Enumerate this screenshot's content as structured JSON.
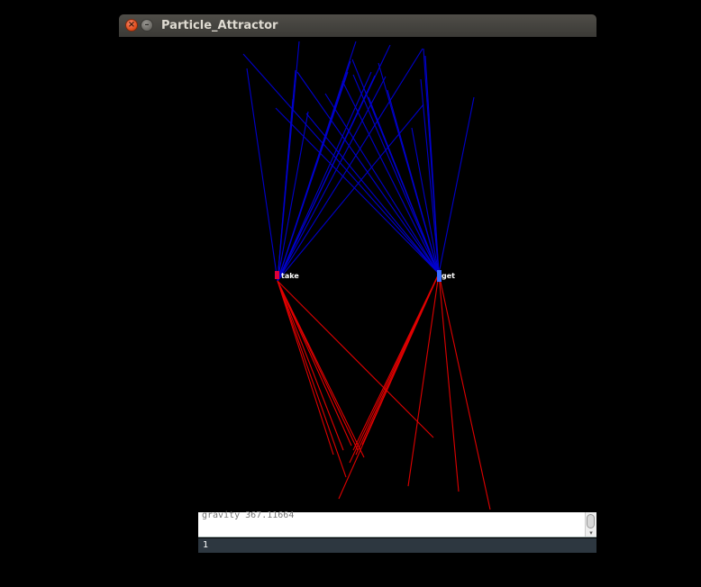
{
  "window": {
    "title": "Particle_Attractor",
    "close_glyph": "×",
    "minimize_glyph": "–"
  },
  "scene": {
    "background": "#000000",
    "attractors": [
      {
        "label": "take",
        "point_color": "#e0003a"
      },
      {
        "label": "get",
        "point_color": "#3b6dff"
      }
    ],
    "upper_line_color": "#0000cc",
    "lower_line_color": "#e00000",
    "label_color": "#ffffff"
  },
  "console": {
    "output_text": "gravity 367.11664",
    "input_text": "1",
    "scroll_down_glyph": "▾"
  }
}
